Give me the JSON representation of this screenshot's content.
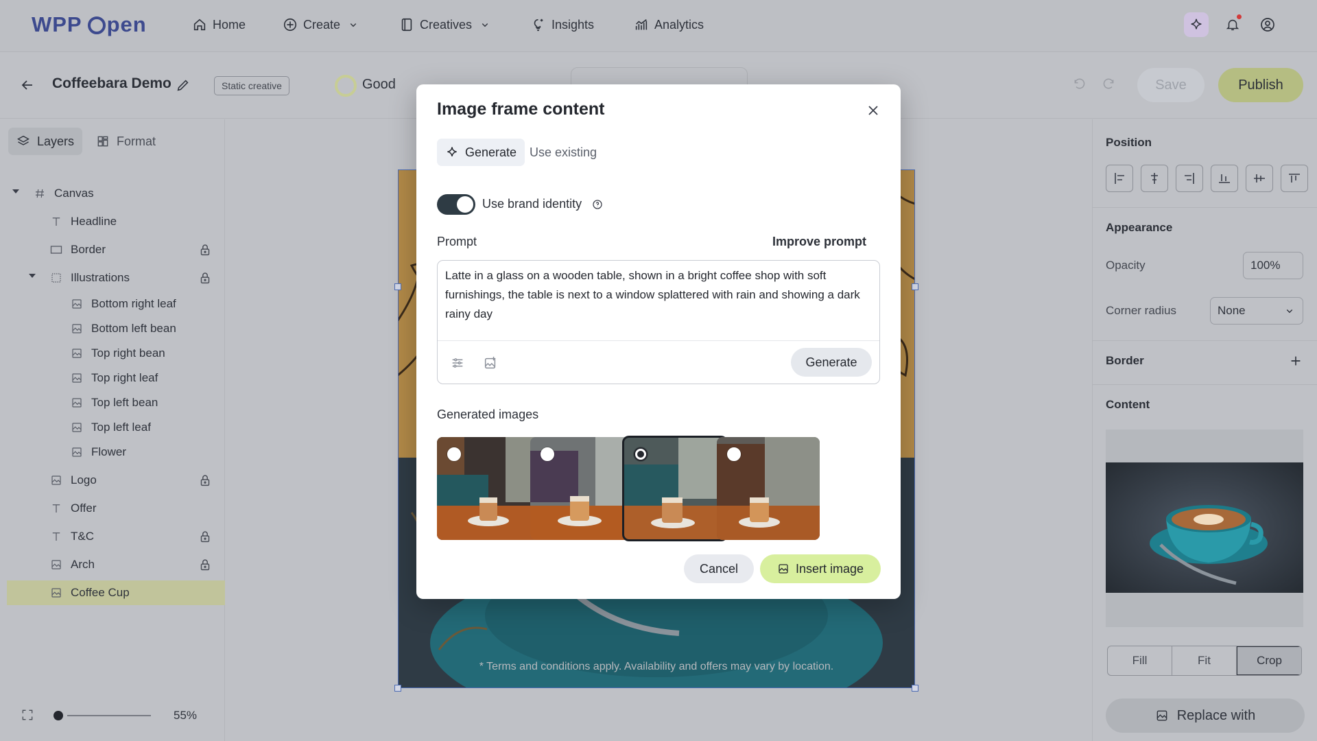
{
  "brand": {
    "part1": "WPP",
    "part2": "pen",
    "icon": "wpp-open-logo"
  },
  "nav": {
    "home": "Home",
    "create": "Create",
    "creatives": "Creatives",
    "insights": "Insights",
    "analytics": "Analytics"
  },
  "topicons": [
    "ai-sparkle-icon",
    "bell-icon",
    "user-avatar-icon"
  ],
  "document": {
    "title": "Coffeebara Demo",
    "badge": "Static creative",
    "quality": "Good",
    "save": "Save",
    "publish": "Publish"
  },
  "left_panel": {
    "tab_layers": "Layers",
    "tab_format": "Format",
    "layers": [
      {
        "label": "Canvas",
        "icon": "hash-icon",
        "locked": false
      },
      {
        "label": "Headline",
        "icon": "text-icon",
        "locked": false
      },
      {
        "label": "Border",
        "icon": "rectangle-icon",
        "locked": true
      },
      {
        "label": "Illustrations",
        "icon": "group-icon",
        "locked": true
      },
      {
        "label": "Bottom right leaf",
        "icon": "image-icon",
        "locked": false
      },
      {
        "label": "Bottom left bean",
        "icon": "image-icon",
        "locked": false
      },
      {
        "label": "Top right bean",
        "icon": "image-icon",
        "locked": false
      },
      {
        "label": "Top right leaf",
        "icon": "image-icon",
        "locked": false
      },
      {
        "label": "Top left bean",
        "icon": "image-icon",
        "locked": false
      },
      {
        "label": "Top left leaf",
        "icon": "image-icon",
        "locked": false
      },
      {
        "label": "Flower",
        "icon": "image-icon",
        "locked": false
      },
      {
        "label": "Logo",
        "icon": "image-icon",
        "locked": true
      },
      {
        "label": "Offer",
        "icon": "text-icon",
        "locked": false
      },
      {
        "label": "T&C",
        "icon": "text-icon",
        "locked": true
      },
      {
        "label": "Arch",
        "icon": "image-icon",
        "locked": true
      },
      {
        "label": "Coffee Cup",
        "icon": "image-icon",
        "locked": false,
        "selected": true
      }
    ],
    "zoom": "55%"
  },
  "canvas": {
    "tc_text": "* Terms and conditions apply. Availability and offers may vary by location."
  },
  "right_panel": {
    "position": "Position",
    "appearance": "Appearance",
    "opacity_label": "Opacity",
    "opacity_value": "100%",
    "corner_label": "Corner radius",
    "corner_value": "None",
    "border": "Border",
    "content": "Content",
    "fill": "Fill",
    "fit": "Fit",
    "crop": "Crop",
    "replace": "Replace with"
  },
  "modal": {
    "title": "Image frame content",
    "tab_generate": "Generate",
    "tab_existing": "Use existing",
    "toggle_label": "Use brand identity",
    "toggle_on": true,
    "prompt_label": "Prompt",
    "improve": "Improve prompt",
    "prompt_text": "Latte in a glass on a wooden table, shown in a bright coffee shop with soft furnishings, the table is next to a window splattered with rain and showing a dark rainy day",
    "generate_btn": "Generate",
    "generated_label": "Generated images",
    "selected_index": 2,
    "cancel": "Cancel",
    "insert": "Insert image"
  },
  "colors": {
    "accent_green": "#d8ef9e",
    "publish_green": "#b5bd82",
    "toggle_dark": "#2e3b44",
    "brand_blue": "#3d4a8e"
  }
}
